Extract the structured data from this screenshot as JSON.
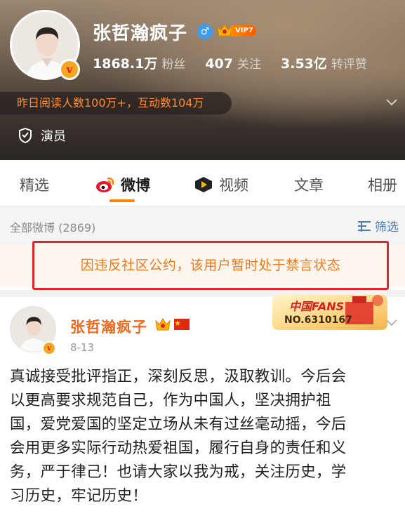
{
  "profile": {
    "name": "张哲瀚疯子",
    "vip_label": "VIP7",
    "avatar_badge": "v",
    "stats": [
      {
        "value": "1868.1万",
        "label": "粉丝"
      },
      {
        "value": "407",
        "label": "关注"
      },
      {
        "value": "3.53亿",
        "label": "转评赞"
      }
    ],
    "highlight": "昨日阅读人数100万+，互动数104万",
    "role": "演员"
  },
  "tabs": [
    {
      "label": "精选",
      "active": false
    },
    {
      "label": "微博",
      "active": true
    },
    {
      "label": "视频",
      "active": false
    },
    {
      "label": "文章",
      "active": false
    },
    {
      "label": "相册",
      "active": false
    }
  ],
  "filter": {
    "all_label": "全部微博 (2869)",
    "filter_label": "筛选"
  },
  "ban_notice": "因违反社区公约，该用户暂时处于禁言状态",
  "post": {
    "author": "张哲瀚疯子",
    "date": "8-13",
    "fans_card_title": "中国FANS",
    "fans_card_number": "NO.6310167",
    "lines": [
      "真诚接受批评指正，深刻反思，汲取教训。今后会",
      "以更高要求规范自己，作为中国人，坚决拥护祖",
      "国，爱党爱国的坚定立场从未有过丝毫动摇，今后",
      "会用更多实际行动热爱祖国，履行自身的责任和义",
      "务，严于律己！也请大家以我为戒，关注历史，学",
      "习历史，牢记历史！"
    ]
  },
  "colors": {
    "accent_orange": "#ff8200",
    "ban_border": "#e1252a",
    "ban_text": "#f07a1a",
    "author_name": "#f06a1e",
    "link_blue": "#4a7bb5"
  },
  "icons": [
    "male-gender-icon",
    "vip-crown-icon",
    "verified-badge-icon",
    "chevron-down-icon",
    "shield-icon",
    "weibo-logo-icon",
    "video-play-icon",
    "filter-icon",
    "china-flag-icon"
  ]
}
